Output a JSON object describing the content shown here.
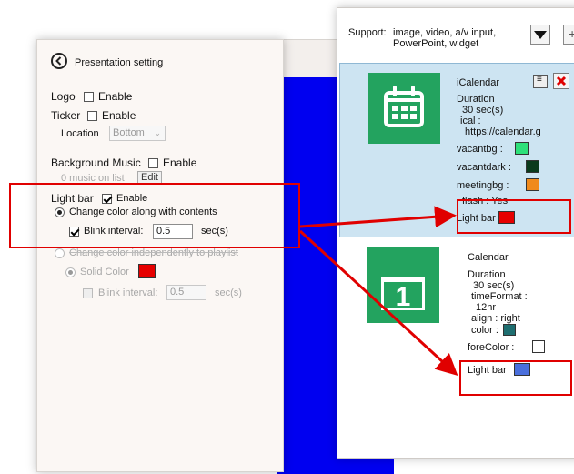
{
  "presentation": {
    "title": "Presentation setting",
    "logo_label": "Logo",
    "logo_enable": "Enable",
    "ticker_label": "Ticker",
    "ticker_enable": "Enable",
    "location_label": "Location",
    "location_value": "Bottom",
    "bg_music_label": "Background Music",
    "bg_music_enable": "Enable",
    "music_count": "0  music on list",
    "edit_label": "Edit",
    "light_bar_label": "Light bar",
    "light_bar_enable": "Enable",
    "opt_along": "Change color along with contents",
    "blink_label": "Blink interval:",
    "blink_value": "0.5",
    "blink_unit": "sec(s)",
    "opt_independent": "Change color independently to playlist",
    "solid_color_label": "Solid Color",
    "blink2_label": "Blink interval:",
    "blink2_value": "0.5",
    "blink2_unit": "sec(s)"
  },
  "support": {
    "label": "Support:",
    "types_line1": "image, video, a/v input,",
    "types_line2": "PowerPoint, widget"
  },
  "widgets": [
    {
      "name": "iCalendar",
      "duration_label": "Duration",
      "duration_value": "30  sec(s)",
      "ical_label": "ical :",
      "ical_value": "https://calendar.g",
      "vacantbg_label": "vacantbg :",
      "vacantdark_label": "vacantdark :",
      "meetingbg_label": "meetingbg :",
      "flash_label": "flash :  Yes",
      "light_bar_label": "Light bar"
    },
    {
      "name": "Calendar",
      "duration_label": "Duration",
      "duration_value": "30  sec(s)",
      "timeformat_label": "timeFormat :",
      "timeformat_value": "12hr",
      "align_label": "align :  right",
      "color_label": "color :",
      "forecolor_label": "foreColor :",
      "light_bar_label": "Light bar",
      "icon_number": "1"
    }
  ],
  "colors": {
    "light_bar_red": "#e60000",
    "light_bar_blue": "#4a6fdc",
    "vacantbg": "#2ee07a",
    "vacantdark": "#0a3a1c",
    "meetingbg": "#f08a1c",
    "cal_color": "#1e6e70",
    "forecolor": "#ffffff",
    "preview_blue": "#0000f0",
    "widget_green": "#23a35f",
    "annotation_red": "#e00000"
  }
}
